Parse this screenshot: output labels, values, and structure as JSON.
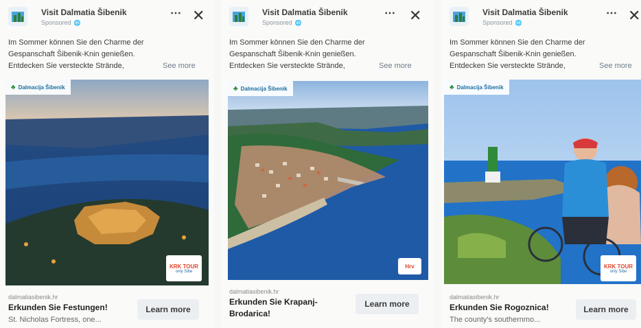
{
  "ads": [
    {
      "page_name": "Visit Dalmatia Šibenik",
      "sponsored": "Sponsored",
      "body_lines": [
        "Im Sommer können Sie den Charme der",
        "Gespanschaft Šibenik-Knin genießen.",
        "Entdecken Sie versteckte Strände,"
      ],
      "see_more": "See more",
      "brand_tag": "Dalmacija Šibenik",
      "badge": "KRK TOUR",
      "badge_sub": "only Sibe",
      "domain": "dalmatiasibenik.hr",
      "headline": "Erkunden Sie Festungen!",
      "description": "St. Nicholas Fortress, one...",
      "cta": "Learn more"
    },
    {
      "page_name": "Visit Dalmatia Šibenik",
      "sponsored": "Sponsored",
      "body_lines": [
        "Im Sommer können Sie den Charme der",
        "Gespanschaft Šibenik-Knin genießen.",
        "Entdecken Sie versteckte Strände,"
      ],
      "see_more": "See more",
      "brand_tag": "Dalmacija Šibenik",
      "badge": "Hrv",
      "badge_sub": "",
      "domain": "dalmatiasibenik.hr",
      "headline": "Erkunden Sie Krapanj-Brodarica!",
      "description": "",
      "cta": "Learn more"
    },
    {
      "page_name": "Visit Dalmatia Šibenik",
      "sponsored": "Sponsored",
      "body_lines": [
        "Im Sommer können Sie den Charme der",
        "Gespanschaft Šibenik-Knin genießen.",
        "Entdecken Sie versteckte Strände,"
      ],
      "see_more": "See more",
      "brand_tag": "Dalmacija Šibenik",
      "badge": "KRK TOUR",
      "badge_sub": "only Sibe",
      "domain": "dalmatiasibenik.hr",
      "headline": "Erkunden Sie Rogoznica!",
      "description": "The county's southernmo...",
      "cta": "Learn more"
    }
  ],
  "icons": {
    "more": "⋯",
    "close": "✕",
    "globe": "globe-icon"
  },
  "colors": {
    "sea": "#1f5fa8",
    "sky": "#a9c7e6",
    "link": "#6e7c8c"
  }
}
